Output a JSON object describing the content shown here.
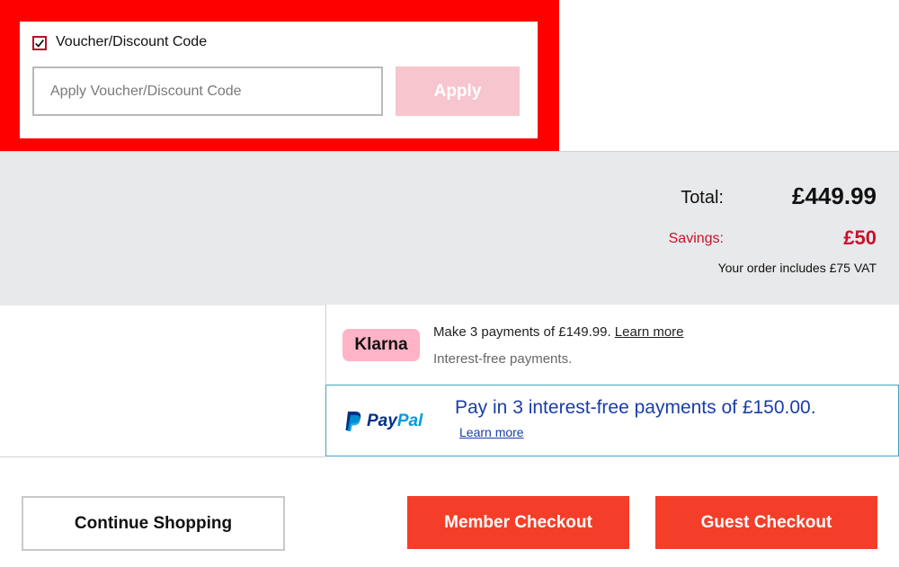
{
  "voucher": {
    "checkbox_checked": true,
    "label": "Voucher/Discount Code",
    "input_placeholder": "Apply Voucher/Discount Code",
    "input_value": "",
    "apply_label": "Apply"
  },
  "totals": {
    "total_label": "Total:",
    "total_value": "£449.99",
    "savings_label": "Savings:",
    "savings_value": "£50",
    "vat_note": "Your order includes £75 VAT"
  },
  "klarna": {
    "logo_text": "Klarna",
    "text": "Make 3 payments of £149.99.",
    "learn_more": "Learn more",
    "subtext": "Interest-free payments."
  },
  "paypal": {
    "logo_pay": "Pay",
    "logo_pal": "Pal",
    "text": "Pay in 3 interest-free payments of £150.00.",
    "learn_more": "Learn more"
  },
  "actions": {
    "continue_label": "Continue Shopping",
    "member_label": "Member Checkout",
    "guest_label": "Guest Checkout"
  },
  "colors": {
    "highlight": "#ff0000",
    "accent": "#f43e2a",
    "savings": "#c8102e",
    "paypal_dark": "#003087",
    "paypal_light": "#009cde",
    "klarna_pink": "#ffb3c7"
  }
}
